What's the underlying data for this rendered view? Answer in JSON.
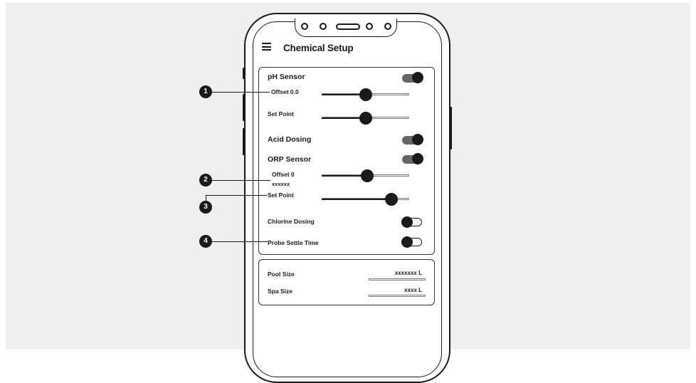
{
  "header": {
    "title": "Chemical Setup",
    "menu_icon": "hamburger-icon"
  },
  "chemistry": {
    "ph_sensor": {
      "label": "pH Sensor",
      "enabled": true
    },
    "ph_offset": {
      "label": "Offset 0.0",
      "level": 0.5
    },
    "ph_setpoint": {
      "label": "Set Point",
      "level": 0.5
    },
    "acid_dosing": {
      "label": "Acid Dosing",
      "enabled": true
    },
    "orp_sensor": {
      "label": "ORP Sensor",
      "enabled": true
    },
    "orp_offset": {
      "label": "Offset 0",
      "sublabel": "xxxxxx",
      "level": 0.52
    },
    "orp_setpoint": {
      "label": "Set Point",
      "level": 0.8
    },
    "chlorine_dosing": {
      "label": "Chlorine Dosing",
      "enabled": false
    },
    "probe_settle": {
      "label": "Probe Settle Time",
      "enabled": false
    }
  },
  "sizes": {
    "pool": {
      "label": "Pool Size",
      "value": "xxxxxxx L"
    },
    "spa": {
      "label": "Spa Size",
      "value": "xxxx L"
    }
  },
  "callouts": [
    "1",
    "2",
    "3",
    "4"
  ]
}
